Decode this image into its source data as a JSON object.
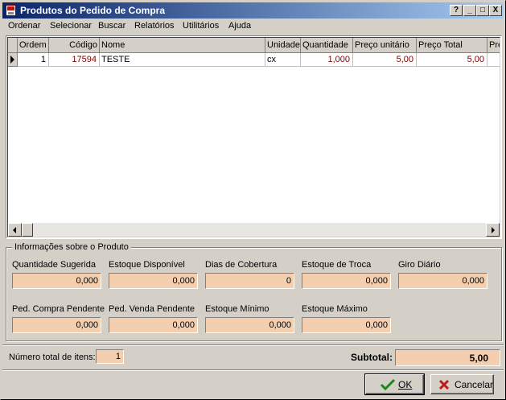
{
  "window": {
    "title": "Produtos do Pedido de Compra",
    "controls": {
      "help": "?",
      "minimize": "_",
      "maximize": "□",
      "close": "X"
    }
  },
  "menu": [
    "Ordenar",
    "Selecionar",
    "Buscar",
    "Relatórios",
    "Utilitários",
    "Ajuda"
  ],
  "grid": {
    "columns": [
      "Ordem",
      "Código",
      "Nome",
      "Unidade",
      "Quantidade",
      "Preço unitário",
      "Preço Total",
      "Pre"
    ],
    "rows": [
      {
        "ordem": "1",
        "codigo": "17594",
        "nome": "TESTE",
        "unidade": "cx",
        "quantidade": "1,000",
        "preco_unitario": "5,00",
        "preco_total": "5,00"
      }
    ]
  },
  "info": {
    "legend": "Informações sobre o Produto",
    "fields": [
      {
        "label": "Quantidade Sugerida",
        "value": "0,000"
      },
      {
        "label": "Estoque Disponível",
        "value": "0,000"
      },
      {
        "label": "Dias de Cobertura",
        "value": "0"
      },
      {
        "label": "Estoque de Troca",
        "value": "0,000"
      },
      {
        "label": "Giro Diário",
        "value": "0,000"
      },
      {
        "label": "Ped. Compra Pendente",
        "value": "0,000"
      },
      {
        "label": "Ped. Venda Pendente",
        "value": "0,000"
      },
      {
        "label": "Estoque Mínimo",
        "value": "0,000"
      },
      {
        "label": "Estoque Máximo",
        "value": "0,000"
      }
    ]
  },
  "footer": {
    "total_items_label": "Número total de itens:",
    "total_items_value": "1",
    "subtotal_label": "Subtotal:",
    "subtotal_value": "5,00"
  },
  "buttons": {
    "ok": "OK",
    "cancel": "Cancelar"
  },
  "colors": {
    "field_bg": "#f3cfb0",
    "value_text": "#800000",
    "title_start": "#0a246a",
    "title_end": "#a6caf0"
  }
}
